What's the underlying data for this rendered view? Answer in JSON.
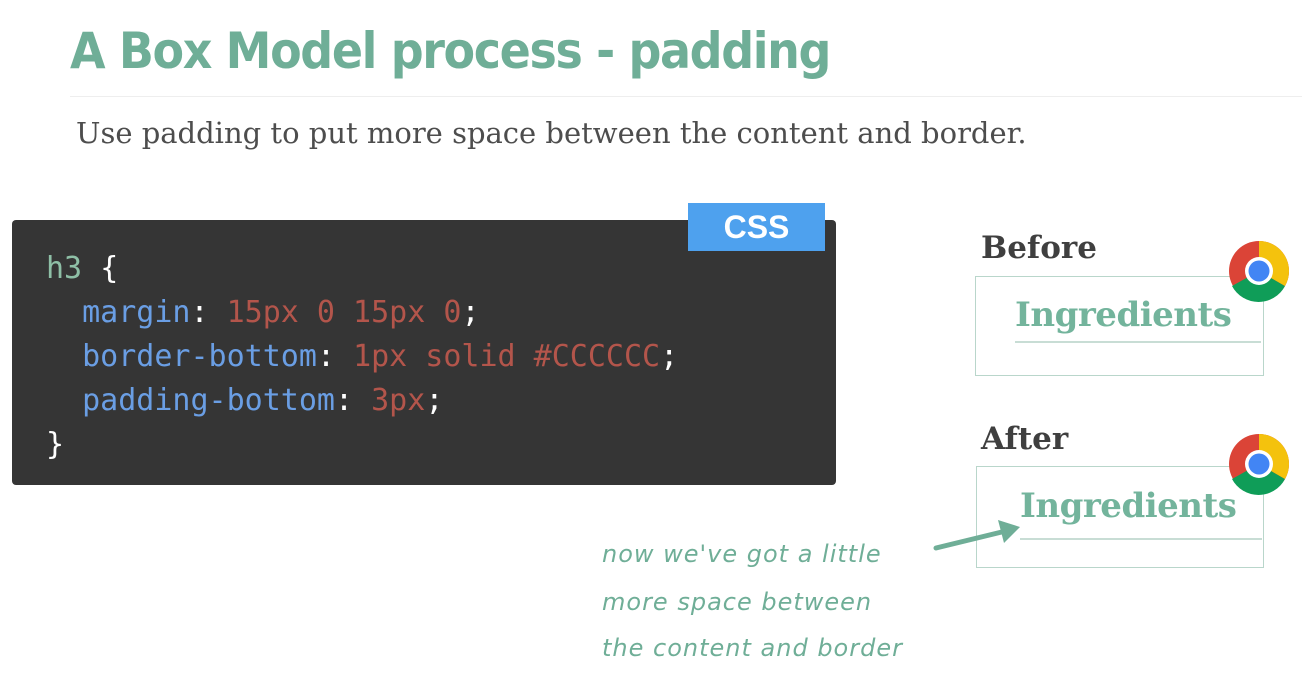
{
  "slide": {
    "title": "A Box Model process - padding",
    "subtitle": "Use padding to put more space between the content and border."
  },
  "code": {
    "badge": "CSS",
    "selector": "h3",
    "open_brace": "{",
    "close_brace": "}",
    "declarations": [
      {
        "property": "margin",
        "value": "15px 0 15px 0"
      },
      {
        "property": "border-bottom",
        "value": "1px solid #CCCCCC"
      },
      {
        "property": "padding-bottom",
        "value": "3px"
      }
    ]
  },
  "examples": {
    "before": {
      "label": "Before",
      "heading": "Ingredients"
    },
    "after": {
      "label": "After",
      "heading": "Ingredients"
    }
  },
  "note": {
    "lines": [
      "now we've got a little",
      "more space between",
      "the content and border"
    ]
  },
  "colors": {
    "accent": "#6fae97",
    "code_bg": "#353535",
    "badge_bg": "#4ea1ee",
    "selector": "#8ebfa6",
    "property": "#6a9ee4",
    "value": "#b3554b"
  },
  "icons": [
    "chrome-logo-icon",
    "arrow-icon"
  ]
}
